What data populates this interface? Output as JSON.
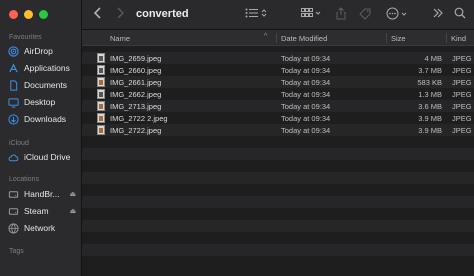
{
  "window": {
    "title": "converted"
  },
  "sidebar": {
    "favourites_label": "Favourites",
    "favourites": [
      {
        "label": "AirDrop",
        "icon": "airdrop-icon"
      },
      {
        "label": "Applications",
        "icon": "applications-icon"
      },
      {
        "label": "Documents",
        "icon": "document-icon"
      },
      {
        "label": "Desktop",
        "icon": "desktop-icon"
      },
      {
        "label": "Downloads",
        "icon": "downloads-icon"
      }
    ],
    "icloud_label": "iCloud",
    "icloud": [
      {
        "label": "iCloud Drive",
        "icon": "cloud-icon"
      }
    ],
    "locations_label": "Locations",
    "locations": [
      {
        "label": "HandBr...",
        "icon": "disk-icon"
      },
      {
        "label": "Steam",
        "icon": "disk-icon"
      },
      {
        "label": "Network",
        "icon": "network-icon"
      }
    ],
    "tags_label": "Tags"
  },
  "columns": {
    "name": "Name",
    "date": "Date Modified",
    "size": "Size",
    "kind": "Kind"
  },
  "files": [
    {
      "name": "IMG_2659.jpeg",
      "date": "Today at 09:34",
      "size": "4 MB",
      "kind": "JPEG i"
    },
    {
      "name": "IMG_2660.jpeg",
      "date": "Today at 09:34",
      "size": "3.7 MB",
      "kind": "JPEG i"
    },
    {
      "name": "IMG_2661.jpeg",
      "date": "Today at 09:34",
      "size": "583 KB",
      "kind": "JPEG i"
    },
    {
      "name": "IMG_2662.jpeg",
      "date": "Today at 09:34",
      "size": "1.3 MB",
      "kind": "JPEG i"
    },
    {
      "name": "IMG_2713.jpeg",
      "date": "Today at 09:34",
      "size": "3.6 MB",
      "kind": "JPEG i"
    },
    {
      "name": "IMG_2722 2.jpeg",
      "date": "Today at 09:34",
      "size": "3.9 MB",
      "kind": "JPEG i"
    },
    {
      "name": "IMG_2722.jpeg",
      "date": "Today at 09:34",
      "size": "3.9 MB",
      "kind": "JPEG i"
    }
  ],
  "colors": {
    "accent": "#3d8fe6",
    "close": "#ff5f57",
    "minimize": "#febc2e",
    "maximize": "#28c840"
  }
}
